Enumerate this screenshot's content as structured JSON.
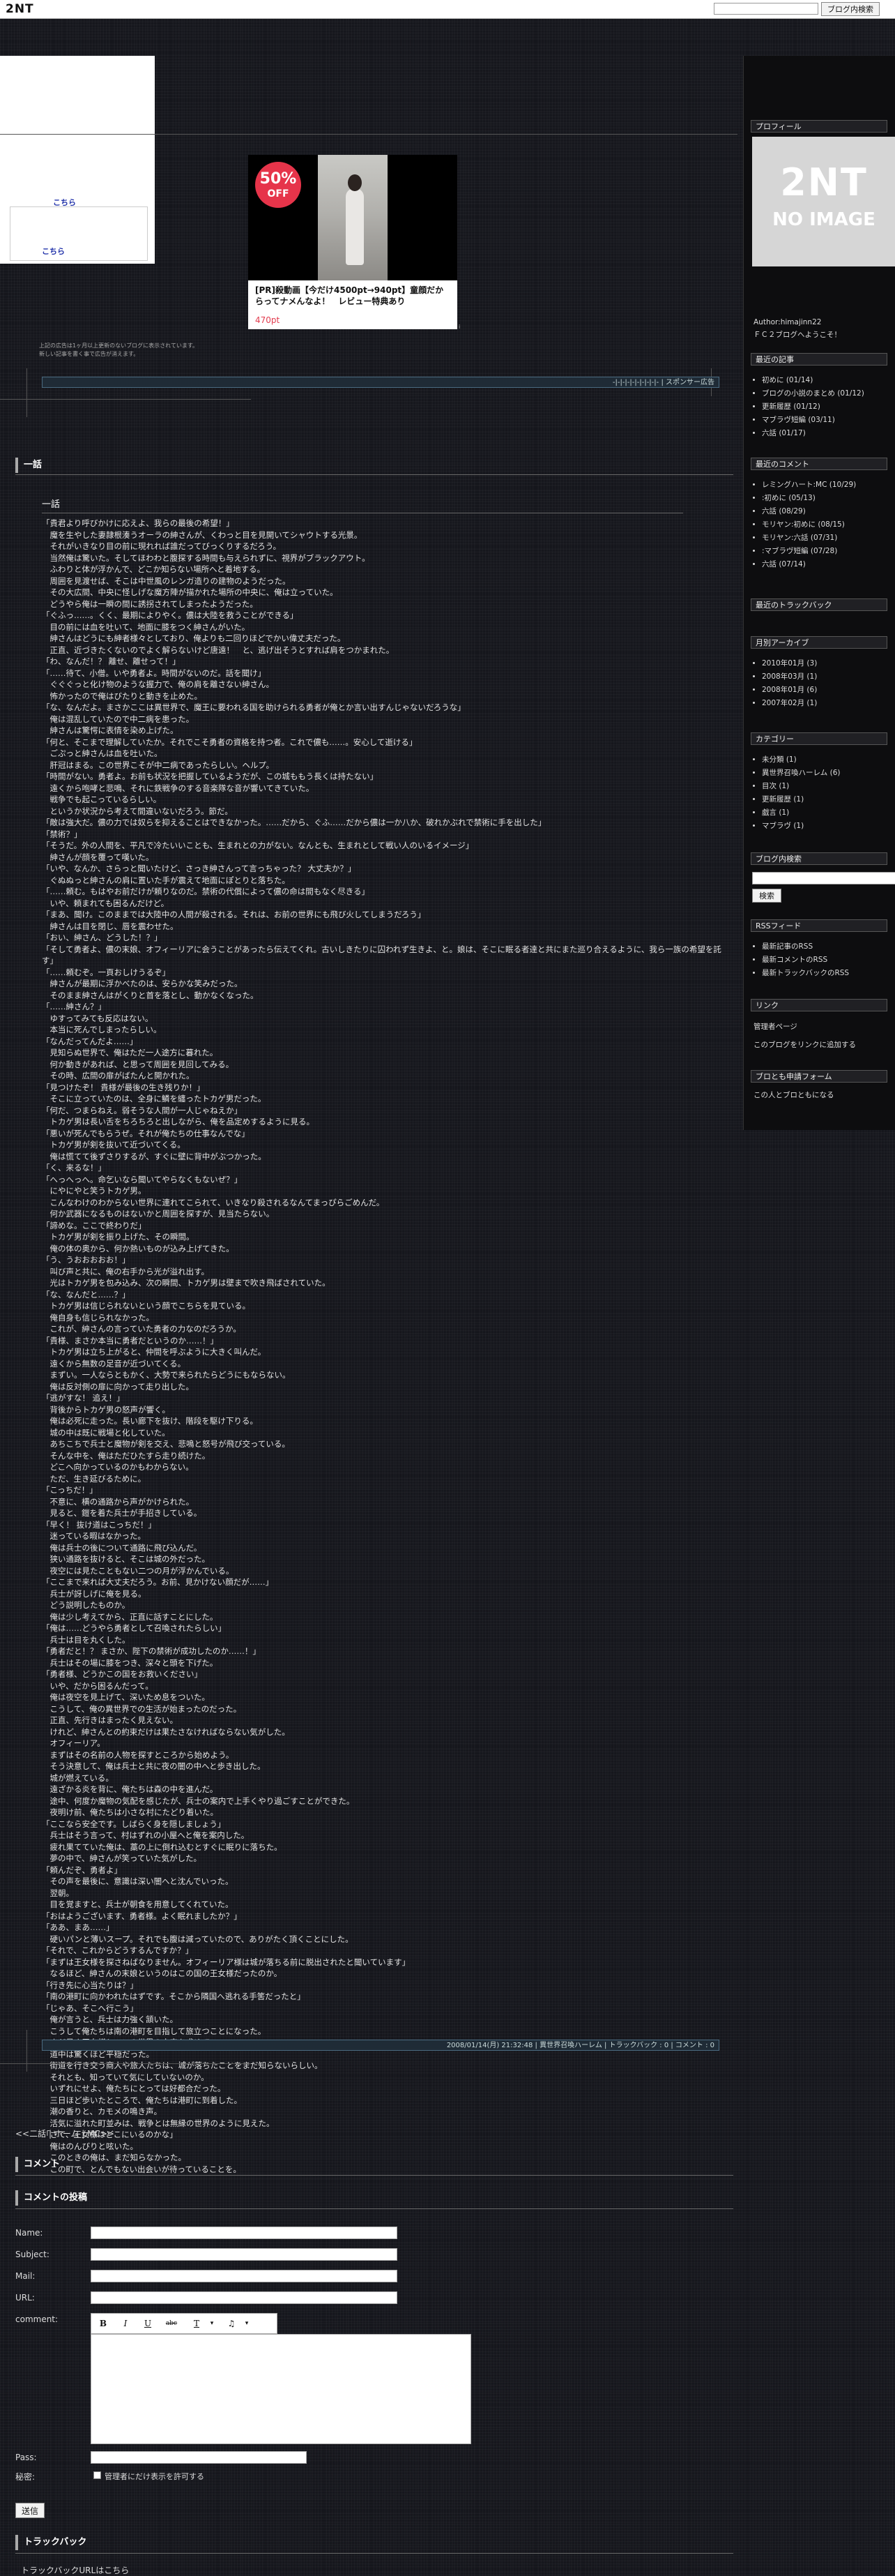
{
  "topbar": {
    "logo": "2NT",
    "search_button": "ブログ内検索"
  },
  "ad": {
    "link1": "こちら",
    "link2": "こちら",
    "note1": "上記の広告は1ヶ月以上更新のないブログに表示されています。",
    "note2": "新しい記事を書く事で広告が消えます。"
  },
  "product": {
    "badge_pct": "50%",
    "badge_off": "OFF",
    "title": "[PR]殺動画【今だけ4500pt→940pt】童顔だからってナメんなよ！　レビュー特典あり",
    "price": "470pt",
    "mark": "i"
  },
  "sponsor": "-|-|-|-|-|-|-|-|-|- | スポンサー広告",
  "post": {
    "section_title": "一話",
    "title": "一話",
    "lines": [
      "「貴君より呼びかけに応えよ、我らの最後の希望！」",
      "　魔を生やした妻隷根湊うオーラの紳さんが、くわっと目を見開いてシャウトする光景。",
      "　それがいきなり目の前に現れれば誰だってびっくりするだろう。",
      "　当然俺は驚いた。そしてほわわと腹探する時間も与えられずに、視界がブラックアウト。",
      "　ふわりと体が浮かんで、どこか知らない場所へと着地する。",
      "　周囲を見渡せば、そこは中世風のレンガ造りの建物のようだった。",
      "　その大広間、中央に怪しげな魔方陣が描かれた場所の中央に、俺は立っていた。",
      "　どうやら俺は一瞬の間に誘拐されてしまったようだった。",
      "「ぐふっ……。くく、最期によりやく。儂は大陸を救うことができる」",
      "　目の前には血を吐いて、地面に膝をつく紳さんがいた。",
      "　紳さんはどうにも紳者様々としており、俺よりも二回りほどでかい偉丈夫だった。",
      "　正直、近づきたくないのでよく解らないけど唐遠！　と、逃げ出そうとすれば肩をつかまれた。",
      "「わ、なんだ！？ 離せ、離せって！」",
      "「……待て、小僧。いや勇者よ。時間がないのだ。話を聞け」",
      "　ぐぐぐっと化け物のような握力で、俺の肩を離さない紳さん。",
      "　怖かったので俺はびたりと動きを止めた。",
      "「な、なんだよ。まさかここは異世界で、魔王に要われる国を助けられる勇者が俺とか言い出すんじゃないだろうな」",
      "　俺は混乱していたので中二病を患った。",
      "　紳さんは驚愕に表情を染め上げた。",
      "「何と、そこまで理解していたか。それでこそ勇者の資格を持つ者。これで儂も……。安心して逝ける」",
      "　ごぷっと紳さんは血を吐いた。",
      "　肝冠はまる。この世界こそが中二病であったらしい。ヘルプ。",
      "「時間がない。勇者よ。お前も状況を把握しているようだが、この城ももう長くは持たない」",
      "　遠くから咆哮と悲鳴、それに鉄戦争のする音楽隊な音が響いてきていた。",
      "　戦争でも起こっているらしい。",
      "　というか状況から考えて間違いないだろう。節だ。",
      "「敵は強大だ。儂の力では奴らを抑えることはできなかった。……だから、ぐふ……だから儂は一か八か、破れかぶれで禁術に手を出した」",
      "「禁術？」",
      "「そうだ。外の人間を、平凡で冷たいいことも、生まれとの力がない。なんとも、生まれとして戦い人のいるイメージ」",
      "　紳さんが顔を覆って嘆いた。",
      "「いや、なんか、さらっと聞いたけど、さっき紳さんって言っちゃった？ 大丈夫か？」",
      "　ぐぬぬっと紳さんの肩に置いた手が震えて地面にぽとりと落ちた。",
      "「……頼む。もはやお前だけが頼りなのだ。禁術の代償によって儂の命は間もなく尽きる」",
      "　いや、頼まれても困るんだけど。",
      "「まあ、聞け。このままでは大陸中の人間が殺される。それは、お前の世界にも飛び火してしまうだろう」",
      "　紳さんは目を閉じ、唇を震わせた。",
      "「おい、紳さん、どうした！？」",
      "「そして勇者よ、儂の末娘、オフィーリアに会うことがあったら伝えてくれ。古いしきたりに囚われず生きよ、と。娘は、そこに眠る者達と共にまた巡り合えるように、我ら一族の希望を託す」",
      "「……頼むぞ。一頁おしけうるぞ」",
      "　紳さんが最期に浮かべたのは、安らかな笑みだった。",
      "　そのまま紳さんはがくりと首を落とし、動かなくなった。",
      "「……紳さん？」",
      "　ゆすってみても反応はない。",
      "　本当に死んでしまったらしい。",
      "「なんだってんだよ……」",
      "　見知らぬ世界で、俺はただ一人途方に暮れた。",
      "　何か動きがあれば、と思って周囲を見回してみる。",
      "　その時、広間の扉がばたんと開かれた。",
      "「見つけたぞ！ 貴様が最後の生き残りか！」",
      "　そこに立っていたのは、全身に鱗を纏ったトカゲ男だった。",
      "「何だ、つまらねえ。弱そうな人間が一人じゃねえか」",
      "　トカゲ男は長い舌をちろちろと出しながら、俺を品定めするように見る。",
      "「悪いが死んでもらうぜ。それが俺たちの仕事なんでな」",
      "　トカゲ男が剣を抜いて近づいてくる。",
      "　俺は慌てて後ずさりするが、すぐに壁に背中がぶつかった。",
      "「く、来るな！」",
      "「へっへっへ。命乞いなら聞いてやらなくもないぜ？」",
      "　にやにやと笑うトカゲ男。",
      "　こんなわけのわからない世界に連れてこられて、いきなり殺されるなんてまっぴらごめんだ。",
      "　何か武器になるものはないかと周囲を探すが、見当たらない。",
      "「諦めな。ここで終わりだ」",
      "　トカゲ男が剣を振り上げた、その瞬間。",
      "　俺の体の奥から、何か熱いものが込み上げてきた。",
      "「う、うおおおおお！」",
      "　叫び声と共に、俺の右手から光が溢れ出す。",
      "　光はトカゲ男を包み込み、次の瞬間、トカゲ男は壁まで吹き飛ばされていた。",
      "「な、なんだと……？」",
      "　トカゲ男は信じられないという顔でこちらを見ている。",
      "　俺自身も信じられなかった。",
      "　これが、紳さんの言っていた勇者の力なのだろうか。",
      "「貴様、まさか本当に勇者だというのか……！」",
      "　トカゲ男は立ち上がると、仲間を呼ぶように大きく叫んだ。",
      "　遠くから無数の足音が近づいてくる。",
      "　まずい。一人ならともかく、大勢で来られたらどうにもならない。",
      "　俺は反対側の扉に向かって走り出した。",
      "「逃がすな！ 追え！」",
      "　背後からトカゲ男の怒声が響く。",
      "　俺は必死に走った。長い廊下を抜け、階段を駆け下りる。",
      "　城の中は既に戦場と化していた。",
      "　あちこちで兵士と魔物が剣を交え、悲鳴と怒号が飛び交っている。",
      "　そんな中を、俺はただひたすら走り続けた。",
      "　どこへ向かっているのかもわからない。",
      "　ただ、生き延びるために。",
      "「こっちだ！」",
      "　不意に、横の通路から声がかけられた。",
      "　見ると、鎧を着た兵士が手招きしている。",
      "「早く！ 抜け道はこっちだ！」",
      "　迷っている暇はなかった。",
      "　俺は兵士の後について通路に飛び込んだ。",
      "　狭い通路を抜けると、そこは城の外だった。",
      "　夜空には見たこともない二つの月が浮かんでいる。",
      "「ここまで来れば大丈夫だろう。お前、見かけない顔だが……」",
      "　兵士が訝しげに俺を見る。",
      "　どう説明したものか。",
      "　俺は少し考えてから、正直に話すことにした。",
      "「俺は……どうやら勇者として召喚されたらしい」",
      "　兵士は目を丸くした。",
      "「勇者だと！？ まさか、陛下の禁術が成功したのか……！」",
      "　兵士はその場に膝をつき、深々と頭を下げた。",
      "「勇者様、どうかこの国をお救いください」",
      "　いや、だから困るんだって。",
      "　俺は夜空を見上げて、深いため息をついた。",
      "　こうして、俺の異世界での生活が始まったのだった。",
      "　正直、先行きはまったく見えない。",
      "　けれど、紳さんとの約束だけは果たさなければならない気がした。",
      "　オフィーリア。",
      "　まずはその名前の人物を探すところから始めよう。",
      "　そう決意して、俺は兵士と共に夜の闇の中へと歩き出した。",
      "　城が燃えている。",
      "　遠ざかる炎を背に、俺たちは森の中を進んだ。",
      "　途中、何度か魔物の気配を感じたが、兵士の案内で上手くやり過ごすことができた。",
      "　夜明け前、俺たちは小さな村にたどり着いた。",
      "「ここなら安全です。しばらく身を隠しましょう」",
      "　兵士はそう言って、村はずれの小屋へと俺を案内した。",
      "　疲れ果てていた俺は、藁の上に倒れ込むとすぐに眠りに落ちた。",
      "　夢の中で、紳さんが笑っていた気がした。",
      "「頼んだぞ、勇者よ」",
      "　その声を最後に、意識は深い闇へと沈んでいった。",
      "　翌朝。",
      "　目を覚ますと、兵士が朝食を用意してくれていた。",
      "「おはようございます、勇者様。よく眠れましたか？」",
      "「ああ、まあ……」",
      "　硬いパンと薄いスープ。それでも腹は減っていたので、ありがたく頂くことにした。",
      "「それで、これからどうするんですか？」",
      "「まずは王女様を探さねばなりません。オフィーリア様は城が落ちる前に脱出されたと聞いています」",
      "　なるほど、紳さんの末娘というのはこの国の王女様だったのか。",
      "「行き先に心当たりは？」",
      "「南の港町に向かわれたはずです。そこから隣国へ逃れる手筈だったと」",
      "「じゃあ、そこへ行こう」",
      "　俺が言うと、兵士は力強く頷いた。",
      "　こうして俺たちは南の港町を目指して旅立つことになった。",
      "　まだ見ぬ王女様と、この世界の未来を求めて。",
      "　道中は驚くほど平穏だった。",
      "　街道を行き交う商人や旅人たちは、城が落ちたことをまだ知らないらしい。",
      "　それとも、知っていて気にしていないのか。",
      "　いずれにせよ、俺たちにとっては好都合だった。",
      "　三日ほど歩いたところで、俺たちは港町に到着した。",
      "　潮の香りと、カモメの鳴き声。",
      "　活気に溢れた町並みは、戦争とは無縁の世界のように見えた。",
      "「さて、王女様はどこにいるのかな」",
      "　俺はのんびりと呟いた。",
      "　このときの俺は、まだ知らなかった。",
      "　この町で、とんでもない出会いが待っていることを。"
    ]
  },
  "post_footer": "2008/01/14(月) 21:32:48 | 異世界召喚ハーレム | トラックバック : 0 | コメント : 0",
  "nav": {
    "prev": "<<二話",
    "home": "ホーム",
    "next": "MC>>"
  },
  "comments": {
    "title": "コメント"
  },
  "form": {
    "title": "コメントの投稿",
    "name": "Name:",
    "subject": "Subject:",
    "mail": "Mail:",
    "url": "URL:",
    "comment": "comment:",
    "pass": "Pass:",
    "secret": "秘密:",
    "secret_option": "管理者にだけ表示を許可する",
    "submit": "送信",
    "toolbar": {
      "bold": "B",
      "italic": "I",
      "underline": "U",
      "strike": "abc",
      "font": "T",
      "color": "♫"
    }
  },
  "trackback": {
    "title": "トラックバック",
    "url_text": "トラックバックURLはこちら"
  },
  "sidebar": {
    "profile": {
      "title": "プロフィール",
      "noimg_logo": "2NT",
      "noimg_text": "NO IMAGE",
      "author": "Author:himajinn22",
      "greeting": "ＦＣ２ブログへようこそ！"
    },
    "recent_posts": {
      "title": "最近の記事",
      "items": [
        "初めに (01/14)",
        "ブログの小説のまとめ (01/12)",
        "更新履歴 (01/12)",
        "マブラヴ短編 (03/11)",
        "六話 (01/17)"
      ]
    },
    "recent_comments": {
      "title": "最近のコメント",
      "items": [
        "レミングハート:MC (10/29)",
        ":初めに (05/13)",
        "六話 (08/29)",
        "モリヤン:初めに (08/15)",
        "モリヤン:六話 (07/31)",
        ":マブラヴ短編 (07/28)",
        "六話 (07/14)"
      ]
    },
    "recent_trackbacks": {
      "title": "最近のトラックバック"
    },
    "archive": {
      "title": "月別アーカイブ",
      "items": [
        "2010年01月 (3)",
        "2008年03月 (1)",
        "2008年01月 (6)",
        "2007年02月 (1)"
      ]
    },
    "category": {
      "title": "カテゴリー",
      "items": [
        "未分類 (1)",
        "異世界召喚ハーレム (6)",
        "目次 (1)",
        "更新履歴 (1)",
        "戯言 (1)",
        "マブラヴ (1)"
      ]
    },
    "search": {
      "title": "ブログ内検索",
      "button": "検索"
    },
    "rss": {
      "title": "RSSフィード",
      "items": [
        "最新記事のRSS",
        "最新コメントのRSS",
        "最新トラックバックのRSS"
      ]
    },
    "links": {
      "title": "リンク",
      "items": [
        "管理者ページ",
        "このブログをリンクに追加する"
      ]
    },
    "form": {
      "title": "ブロとも申請フォーム",
      "text": "この人とブロともになる"
    }
  }
}
